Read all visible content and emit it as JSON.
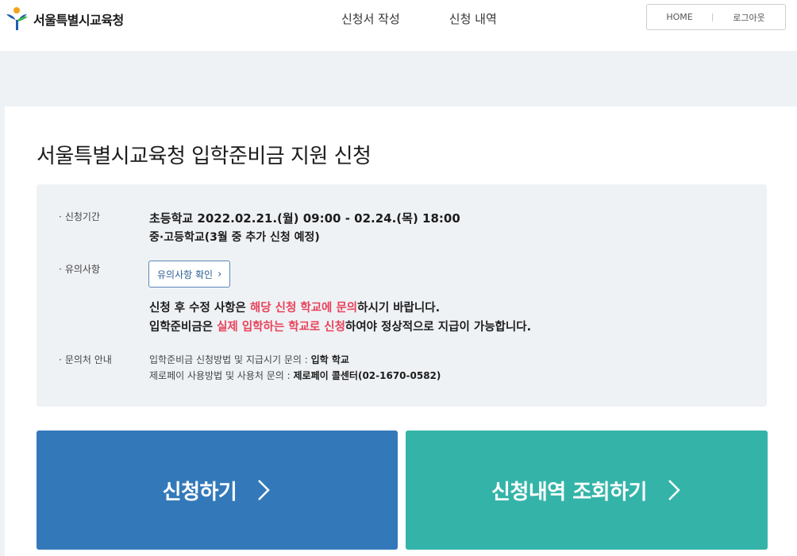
{
  "header": {
    "logo_text": "서울특별시교육청",
    "nav": [
      "신청서 작성",
      "신청 내역"
    ],
    "home_label": "HOME",
    "logout_label": "로그아웃"
  },
  "main": {
    "title": "서울특별시교육청 입학준비금 지원 신청",
    "period": {
      "label": "신청기간",
      "line1": "초등학교 2022.02.21.(월) 09:00 - 02.24.(목) 18:00",
      "line2": "중·고등학교(3월 중 추가 신청 예정)"
    },
    "notice": {
      "label": "유의사항",
      "button_label": "유의사항 확인",
      "line1_a": "신청 후 수정 사항은 ",
      "line1_b": "해당 신청 학교에 문의",
      "line1_c": "하시기 바랍니다.",
      "line2_a": "입학준비금은 ",
      "line2_b": "실제 입학하는 학교로 신청",
      "line2_c": "하여야 정상적으로 지급이 가능합니다."
    },
    "contact": {
      "label": "문의처 안내",
      "line1_text": "입학준비금 신청방법 및 지급시기 문의 : ",
      "line1_bold": "입학 학교",
      "line2_text": "제로페이 사용방법 및 사용처 문의 : ",
      "line2_bold": "제로페이 콜센터(02-1670-0582)"
    },
    "buttons": {
      "apply": "신청하기",
      "view": "신청내역 조회하기"
    }
  },
  "colors": {
    "apply": "#3379ba",
    "view": "#34b4a9",
    "highlight": "#e8425a",
    "logo_blue": "#1f5fae",
    "logo_green": "#3fb24a",
    "logo_orange": "#f4a21c"
  }
}
